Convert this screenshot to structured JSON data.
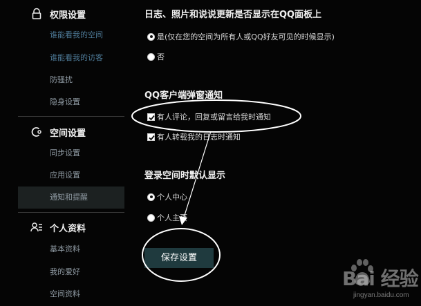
{
  "sidebar": {
    "sections": [
      {
        "title": "权限设置",
        "items": [
          "谁能看我的空间",
          "谁能看我的访客",
          "防骚扰",
          "隐身设置"
        ]
      },
      {
        "title": "空间设置",
        "items": [
          "同步设置",
          "应用设置",
          "通知和提醒"
        ]
      },
      {
        "title": "个人资料",
        "items": [
          "基本资料",
          "我的爱好",
          "空间资料"
        ]
      }
    ],
    "active_item": "通知和提醒"
  },
  "main": {
    "feed_section": {
      "title": "日志、照片和说说更新是否显示在QQ面板上",
      "options": [
        {
          "label": "是(仅在您的空间为所有人或QQ好友可见的时候显示)",
          "selected": true
        },
        {
          "label": "否",
          "selected": false
        }
      ]
    },
    "notify_section": {
      "title": "QQ客户端弹窗通知",
      "options": [
        {
          "label": "有人评论，回复或留言给我时通知",
          "checked": true
        },
        {
          "label": "有人转载我的日志时通知",
          "checked": true
        }
      ]
    },
    "default_section": {
      "title": "登录空间时默认显示",
      "options": [
        {
          "label": "个人中心",
          "selected": true
        },
        {
          "label": "个人主页",
          "selected": false
        }
      ]
    },
    "save_label": "保存设置"
  },
  "watermark": {
    "brand": "Bai 经验",
    "url": "jingyan.baidu.com"
  },
  "colors": {
    "background": "#050505",
    "sidebar_link": "#4d7996",
    "sidebar_text": "#8f9aa3",
    "active_bg": "#1c2121",
    "button_bg": "#1f3a3e"
  }
}
